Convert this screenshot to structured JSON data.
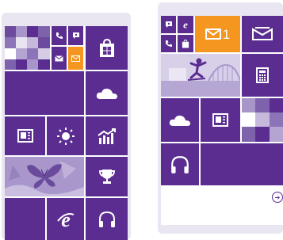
{
  "phones": {
    "left": {
      "tiles": [
        {
          "name": "photo-mosaic-tile"
        },
        {
          "name": "phone-tile",
          "icon": "phone-icon"
        },
        {
          "name": "messaging-tile",
          "icon": "messaging-icon"
        },
        {
          "name": "mail-mini-tile",
          "icon": "mail-icon"
        },
        {
          "name": "mail-orange-mini-tile",
          "icon": "mail-icon"
        },
        {
          "name": "store-tile",
          "icon": "store-icon"
        },
        {
          "name": "wide-tile"
        },
        {
          "name": "onedrive-tile",
          "icon": "cloud-icon"
        },
        {
          "name": "news-tile",
          "icon": "newspaper-icon"
        },
        {
          "name": "weather-tile",
          "icon": "sun-icon"
        },
        {
          "name": "money-tile",
          "icon": "chart-icon"
        },
        {
          "name": "photos-butterfly-tile"
        },
        {
          "name": "games-tile",
          "icon": "trophy-icon"
        },
        {
          "name": "ie-tile",
          "icon": "ie-icon"
        },
        {
          "name": "music-tile",
          "icon": "headphones-icon"
        }
      ]
    },
    "right": {
      "mail_badge": "1",
      "tiles": [
        {
          "name": "messaging-tile",
          "icon": "messaging-icon"
        },
        {
          "name": "ie-small-tile",
          "icon": "ie-icon"
        },
        {
          "name": "phone-tile",
          "icon": "phone-icon"
        },
        {
          "name": "store-small-tile",
          "icon": "store-icon"
        },
        {
          "name": "mail-tile",
          "icon": "mail-icon"
        },
        {
          "name": "outlook-tile",
          "icon": "outlook-icon"
        },
        {
          "name": "skater-photo-tile"
        },
        {
          "name": "calculator-tile",
          "icon": "calculator-icon"
        },
        {
          "name": "onedrive-tile",
          "icon": "cloud-icon"
        },
        {
          "name": "news-tile",
          "icon": "newspaper-icon"
        },
        {
          "name": "photo-mosaic-tile"
        },
        {
          "name": "music-tile",
          "icon": "headphones-icon"
        },
        {
          "name": "wide-tile"
        }
      ],
      "all_apps_arrow": "➔"
    }
  },
  "colors": {
    "tile": "#5b2d91",
    "accent": "#f4961f",
    "light": "#a895c9",
    "frame": "#e9e6f1"
  }
}
